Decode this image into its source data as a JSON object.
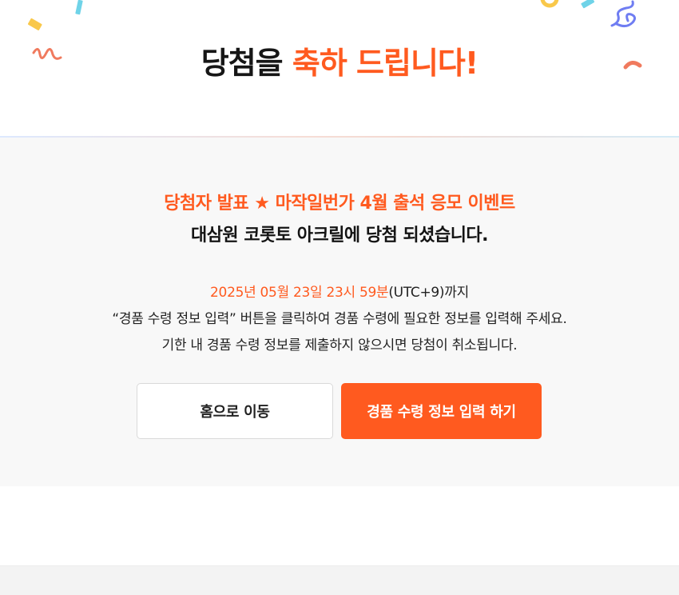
{
  "header": {
    "title_prefix": "당첨을 ",
    "title_accent": "축하 드립니다!"
  },
  "announcement": {
    "event_line": "당첨자 발표 ★ 마작일번가 4월 출석 응모 이벤트",
    "result_line": "대삼원 코롯토 아크릴에 당첨 되셨습니다."
  },
  "instructions": {
    "deadline": "2025년 05월 23일 23시 59분",
    "deadline_suffix": "(UTC+9)까지",
    "line2": "“경품 수령 정보 입력” 버튼을 클릭하여 경품 수령에 필요한 정보를 입력해 주세요.",
    "line3": "기한 내 경품 수령 정보를 제출하지 않으시면 당첨이 취소됩니다."
  },
  "buttons": {
    "home": "홈으로 이동",
    "prize_info": "경품 수령 정보 입력 하기"
  },
  "colors": {
    "accent": "#ff5a1f",
    "panel_bg": "#f8f8f8",
    "confetti_yellow": "#f9c84a",
    "confetti_cyan": "#6fd3e8",
    "confetti_blue": "#6f7df2",
    "confetti_coral": "#f07a5e"
  }
}
